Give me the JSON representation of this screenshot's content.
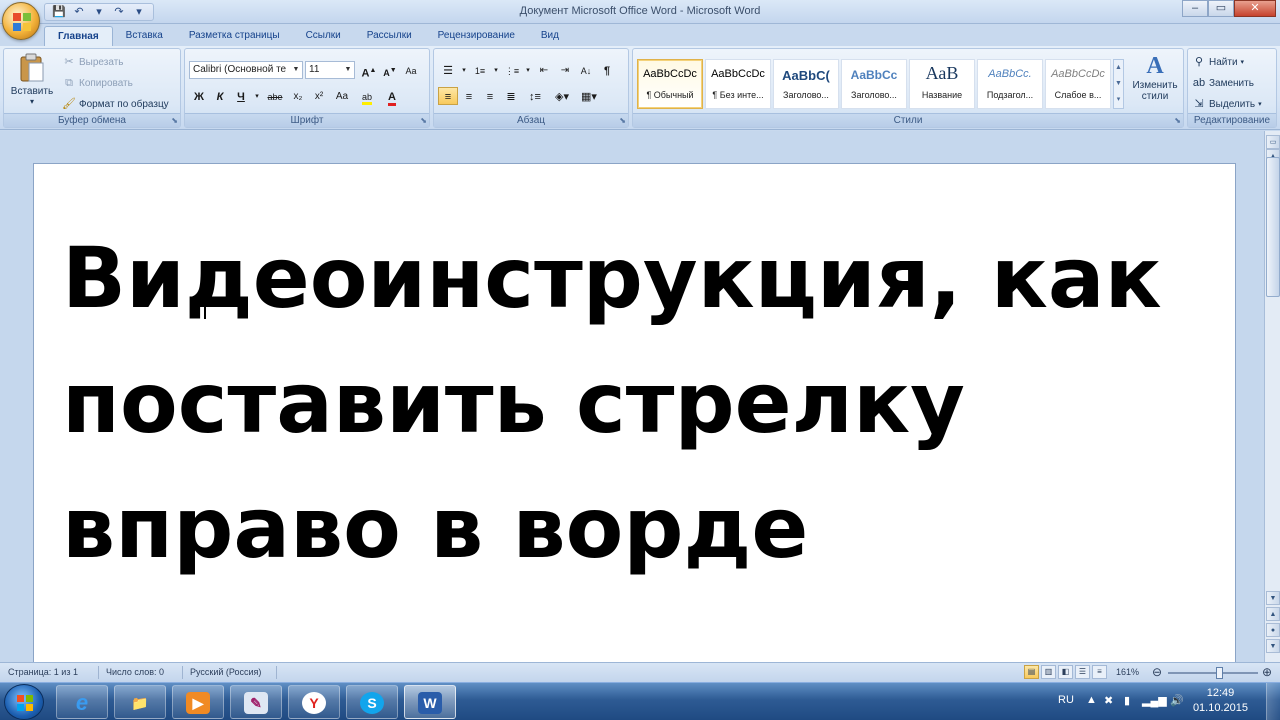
{
  "window": {
    "title": "Документ Microsoft Office Word - Microsoft Word",
    "minimize_glyph": "–",
    "maximize_glyph": "▭",
    "close_glyph": "✕"
  },
  "quick_access": [
    {
      "name": "save",
      "glyph": "💾"
    },
    {
      "name": "undo",
      "glyph": "↶"
    },
    {
      "name": "undo-dropdown",
      "glyph": "▾"
    },
    {
      "name": "redo",
      "glyph": "↷"
    },
    {
      "name": "customize",
      "glyph": "▾"
    }
  ],
  "tabs": [
    "Главная",
    "Вставка",
    "Разметка страницы",
    "Ссылки",
    "Рассылки",
    "Рецензирование",
    "Вид"
  ],
  "clipboard": {
    "paste": "Вставить",
    "cut": "Вырезать",
    "copy": "Копировать",
    "format_painter": "Формат по образцу",
    "label": "Буфер обмена"
  },
  "font": {
    "name": "Calibri (Основной те",
    "size": "11",
    "grow": "A",
    "shrink": "A",
    "clear": "Aa",
    "bold": "Ж",
    "italic": "К",
    "underline": "Ч",
    "strike": "abe",
    "subscript": "x₂",
    "superscript": "x²",
    "case": "Aa",
    "highlight": "ab",
    "color": "A",
    "label": "Шрифт"
  },
  "paragraph": {
    "label": "Абзац",
    "pilcrow": "¶"
  },
  "styles": {
    "label": "Стили",
    "items": [
      {
        "sample": "AaBbCcDc",
        "name": "¶ Обычный"
      },
      {
        "sample": "AaBbCcDc",
        "name": "¶ Без инте..."
      },
      {
        "sample": "AaBbC(",
        "name": "Заголово..."
      },
      {
        "sample": "AaBbCc",
        "name": "Заголово..."
      },
      {
        "sample": "АаВ",
        "name": "Название"
      },
      {
        "sample": "AaBbCc.",
        "name": "Подзагол..."
      },
      {
        "sample": "AaBbCcDc",
        "name": "Слабое в..."
      }
    ],
    "change_styles": "Изменить стили"
  },
  "editing": {
    "find": "Найти",
    "replace": "Заменить",
    "select": "Выделить",
    "label": "Редактирование"
  },
  "document": {
    "text": "Видеоинструкция, как поставить стрелку вправо в ворде"
  },
  "status": {
    "page": "Страница: 1 из 1",
    "words": "Число слов: 0",
    "language": "Русский (Россия)",
    "zoom": "161%",
    "zoom_level_percent": 161
  },
  "taskbar": {
    "apps": [
      {
        "name": "internet-explorer",
        "glyph": "e"
      },
      {
        "name": "file-explorer",
        "glyph": "📁"
      },
      {
        "name": "media-player",
        "glyph": "▶"
      },
      {
        "name": "paint-tool",
        "glyph": "✎"
      },
      {
        "name": "yandex-browser",
        "glyph": "Y"
      },
      {
        "name": "skype",
        "glyph": "S"
      },
      {
        "name": "word",
        "glyph": "W"
      }
    ],
    "lang": "RU",
    "time": "12:49",
    "date": "01.10.2015"
  },
  "colors": {
    "accent": "#15428b",
    "ribbon": "#dce8f6",
    "taskbar": "#2e5b94"
  }
}
